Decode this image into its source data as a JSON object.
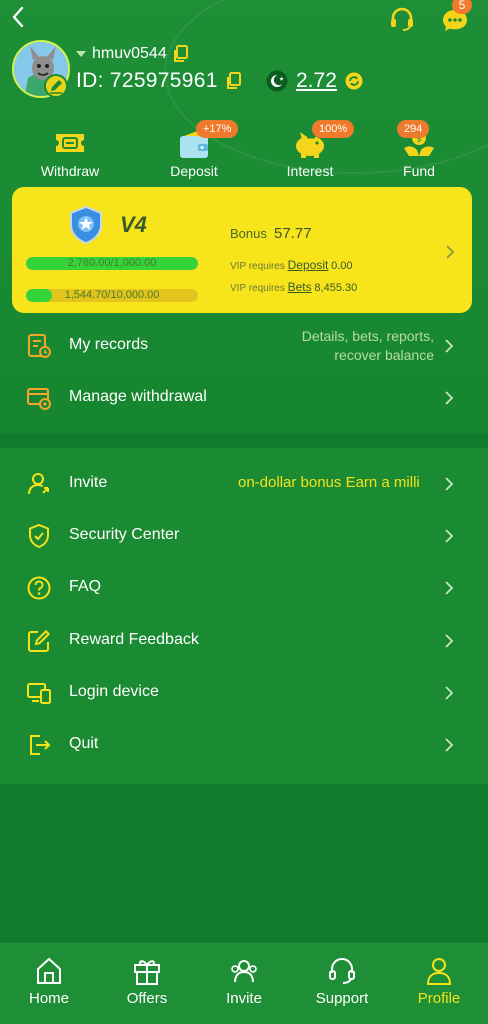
{
  "header": {
    "chat_badge": "5",
    "username": "hmuv0544",
    "id_text": "ID: 725975961",
    "balance": "2.72"
  },
  "actions": [
    {
      "label": "Withdraw",
      "icon": "ticket-icon",
      "badge": ""
    },
    {
      "label": "Deposit",
      "icon": "wallet-icon",
      "badge": "+17%"
    },
    {
      "label": "Interest",
      "icon": "piggy-bank-icon",
      "badge": "100%"
    },
    {
      "label": "Fund",
      "icon": "hands-coin-icon",
      "badge": "294"
    }
  ],
  "vip": {
    "level": "V4",
    "bar1_text": "2,780.00/1,000.00",
    "bar1_progress": 1.0,
    "bar2_text": "1,544.70/10,000.00",
    "bar2_progress": 0.154,
    "bonus_label": "Bonus",
    "bonus_value": "57.77",
    "req_prefix": "VIP requires",
    "deposit_label": "Deposit",
    "deposit_value": "0.00",
    "bets_label": "Bets",
    "bets_value": "8,455.30"
  },
  "records": {
    "label": "My records",
    "desc_line1": "Details, bets, reports,",
    "desc_line2": "recover balance"
  },
  "manage_withdrawal": {
    "label": "Manage withdrawal"
  },
  "menu": {
    "invite": {
      "label": "Invite",
      "marquee": "on-dollar bonus  Earn a milli"
    },
    "security": {
      "label": "Security Center"
    },
    "faq": {
      "label": "FAQ"
    },
    "feedback": {
      "label": "Reward Feedback"
    },
    "login_device": {
      "label": "Login device"
    },
    "quit": {
      "label": "Quit"
    }
  },
  "tabs": [
    {
      "label": "Home",
      "icon": "home-icon",
      "active": false
    },
    {
      "label": "Offers",
      "icon": "gift-icon",
      "active": false
    },
    {
      "label": "Invite",
      "icon": "invite-people-icon",
      "active": false
    },
    {
      "label": "Support",
      "icon": "headset-icon",
      "active": false
    },
    {
      "label": "Profile",
      "icon": "profile-icon",
      "active": true
    }
  ],
  "colors": {
    "background": "#1a8a33",
    "accent_yellow": "#f7e41a",
    "badge_orange": "#f07a2c",
    "progress_green": "#34d33a"
  }
}
